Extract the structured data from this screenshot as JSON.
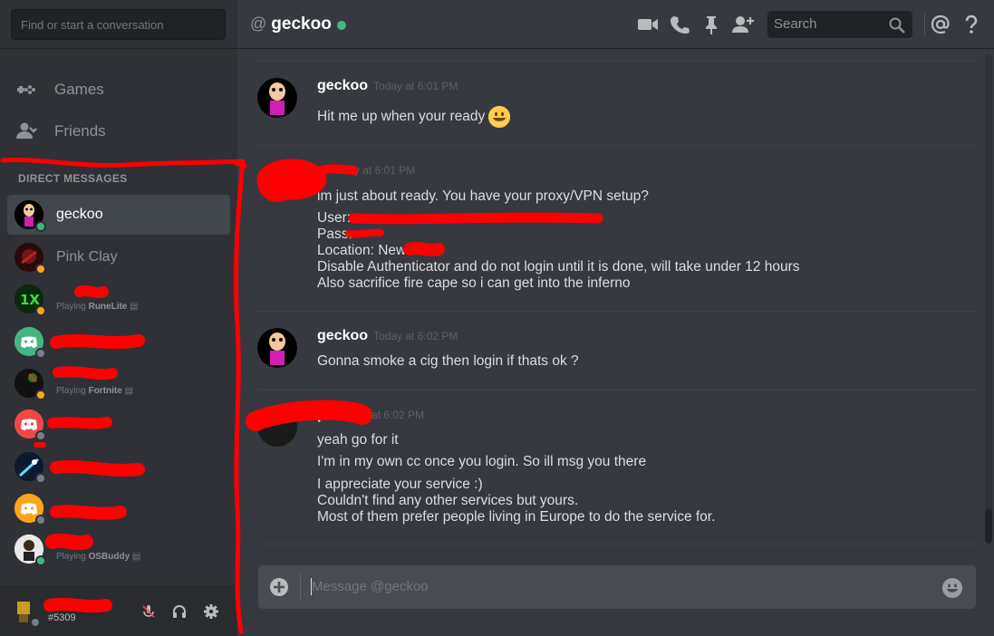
{
  "sidebar": {
    "search_placeholder": "Find or start a conversation",
    "nav": [
      {
        "label": "Games",
        "icon": "gamepad-icon"
      },
      {
        "label": "Friends",
        "icon": "friends-icon"
      }
    ],
    "dm_header": "DIRECT MESSAGES",
    "dms": [
      {
        "name": "geckoo",
        "activity": "",
        "status": "online",
        "active": true
      },
      {
        "name": "Pink Clay",
        "activity": "",
        "status": "idle",
        "active": false
      },
      {
        "name": "",
        "activity_prefix": "Playing",
        "activity_game": "RuneLite",
        "status": "idle",
        "active": false
      },
      {
        "name": "",
        "activity": "",
        "status": "offline",
        "active": false
      },
      {
        "name": "",
        "activity_prefix": "Playing",
        "activity_game": "Fortnite",
        "status": "idle",
        "active": false
      },
      {
        "name": "",
        "activity": "",
        "status": "offline",
        "active": false
      },
      {
        "name": "",
        "activity": "",
        "status": "offline",
        "active": false
      },
      {
        "name": "",
        "activity": "",
        "status": "offline",
        "active": false
      },
      {
        "name": "",
        "activity_prefix": "Playing",
        "activity_game": "OSBuddy",
        "status": "online",
        "active": false
      }
    ],
    "user": {
      "discriminator": "#5309"
    }
  },
  "header": {
    "at": "@",
    "channel": "geckoo",
    "search_placeholder": "Search"
  },
  "messages": [
    {
      "author": "geckoo",
      "time": "Today at 6:01 PM",
      "lines": [
        "Hit me up when your ready"
      ]
    },
    {
      "author": "",
      "author_suffix": "e",
      "time": "Today at 6:01 PM",
      "lines": [
        "im just about ready. You have your proxy/VPN setup?",
        "User:",
        "Pass:",
        "Location: New",
        "Disable Authenticator and do not login until it is done, will take under 12 hours",
        "Also sacrifice fire cape so i can get into the inferno"
      ]
    },
    {
      "author": "geckoo",
      "time": "Today at 6:02 PM",
      "lines": [
        "Gonna smoke a cig then login if thats ok ?"
      ]
    },
    {
      "author": "",
      "author_suffix": "pe",
      "time": "Today at 6:02 PM",
      "lines": [
        "yeah go for it",
        "I'm in my own cc once you login. So ill msg you there",
        "I appreciate  your service :)",
        "Couldn't find any other services but yours.",
        "Most of them prefer people living in Europe to do the service for."
      ]
    }
  ],
  "composer": {
    "placeholder": "Message @geckoo"
  },
  "colors": {
    "online": "#43b581",
    "idle": "#faa61a",
    "offline": "#747f8d",
    "scribble": "#ff0000",
    "blurple": "#7289da"
  }
}
